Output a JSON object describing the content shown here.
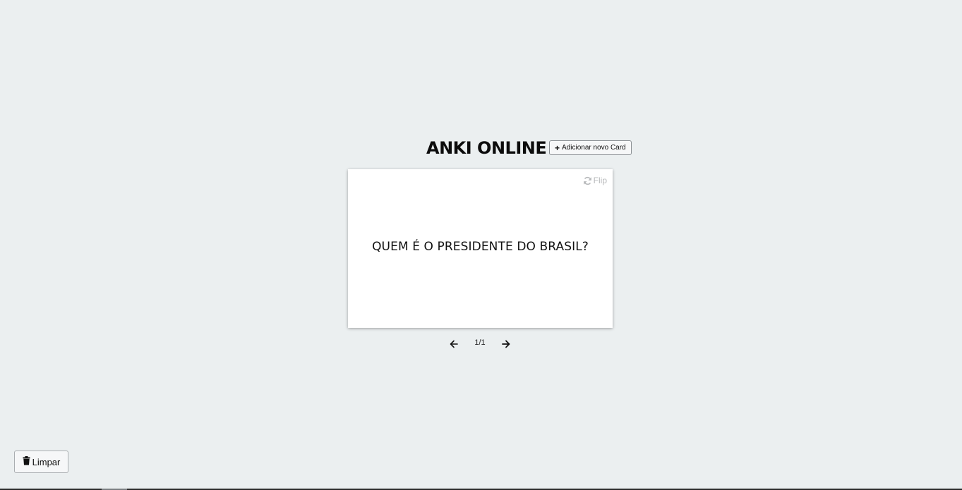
{
  "header": {
    "title": "ANKI ONLINE",
    "add_button_label": "Adicionar novo Card",
    "add_button_icon": "plus-icon"
  },
  "card": {
    "flip_label": "Flip",
    "flip_icon": "refresh-icon",
    "question": "QUEM É O PRESIDENTE DO BRASIL?"
  },
  "pager": {
    "prev_icon": "arrow-left-icon",
    "next_icon": "arrow-right-icon",
    "count": "1/1"
  },
  "footer": {
    "clear_label": "Limpar",
    "clear_icon": "trash-icon"
  },
  "colors": {
    "background": "#ebeff0",
    "card": "#ffffff",
    "muted": "#b7b9bb"
  }
}
